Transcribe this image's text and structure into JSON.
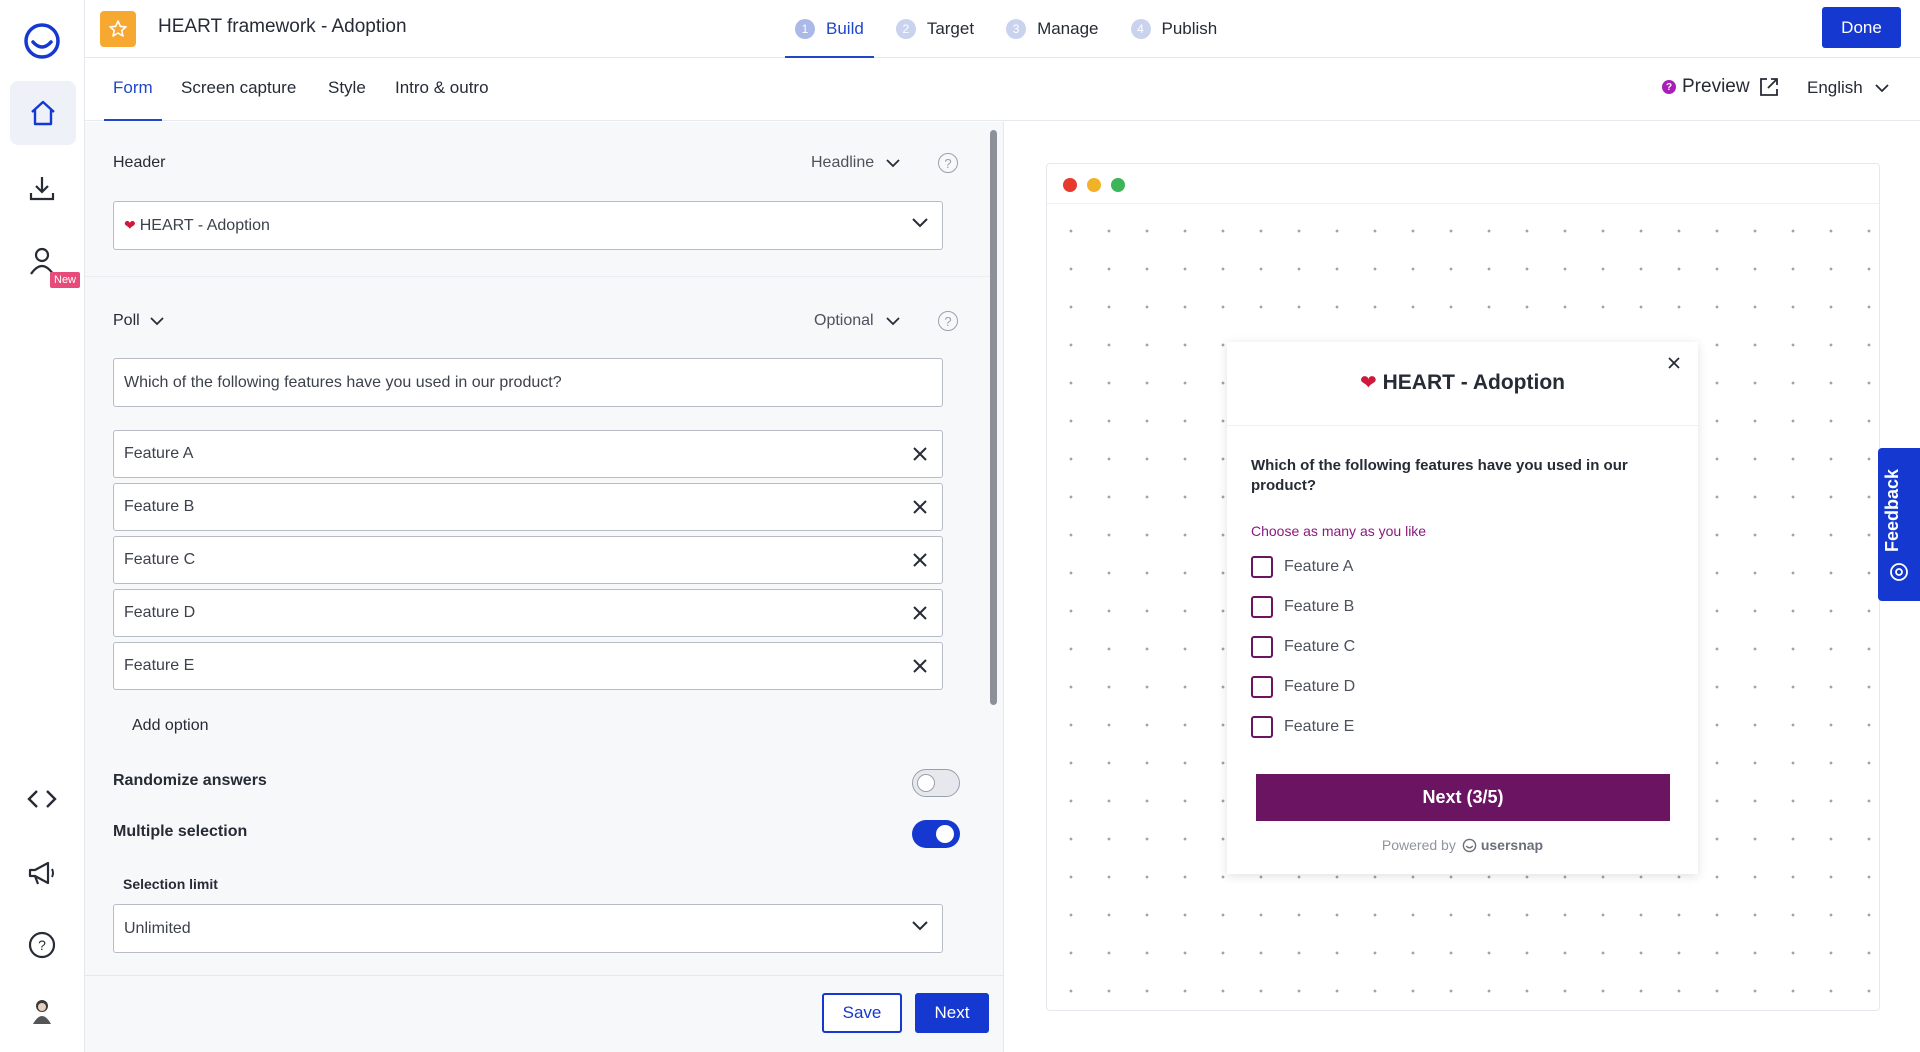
{
  "rail": {
    "new_badge": "New"
  },
  "topbar": {
    "title": "HEART framework - Adoption",
    "steps": [
      {
        "num": "1",
        "label": "Build"
      },
      {
        "num": "2",
        "label": "Target"
      },
      {
        "num": "3",
        "label": "Manage"
      },
      {
        "num": "4",
        "label": "Publish"
      }
    ],
    "active_step": "Build",
    "done_label": "Done"
  },
  "subtabs": [
    "Form",
    "Screen capture",
    "Style",
    "Intro & outro"
  ],
  "active_subtab": "Form",
  "preview_label": "Preview",
  "language": "English",
  "form": {
    "header_label": "Header",
    "header_type": "Headline",
    "header_value": "HEART - Adoption",
    "poll_label": "Poll",
    "poll_required": "Optional",
    "question": "Which of the following features have you used in our product?",
    "options": [
      "Feature A",
      "Feature B",
      "Feature C",
      "Feature D",
      "Feature E"
    ],
    "add_option": "Add option",
    "randomize_label": "Randomize answers",
    "randomize_on": false,
    "multiple_label": "Multiple selection",
    "multiple_on": true,
    "selection_limit_label": "Selection limit",
    "selection_limit_value": "Unlimited",
    "save_label": "Save",
    "next_label": "Next"
  },
  "widget": {
    "title": "HEART - Adoption",
    "question": "Which of the following features have you used in our product?",
    "hint": "Choose as many as you like",
    "options": [
      "Feature A",
      "Feature B",
      "Feature C",
      "Feature D",
      "Feature E"
    ],
    "next_label": "Next (3/5)",
    "powered_by": "Powered by",
    "brand": "usersnap"
  },
  "feedback_tab": "Feedback",
  "colors": {
    "primary": "#1438d0",
    "widget_accent": "#6b1461",
    "star": "#f7a830"
  }
}
